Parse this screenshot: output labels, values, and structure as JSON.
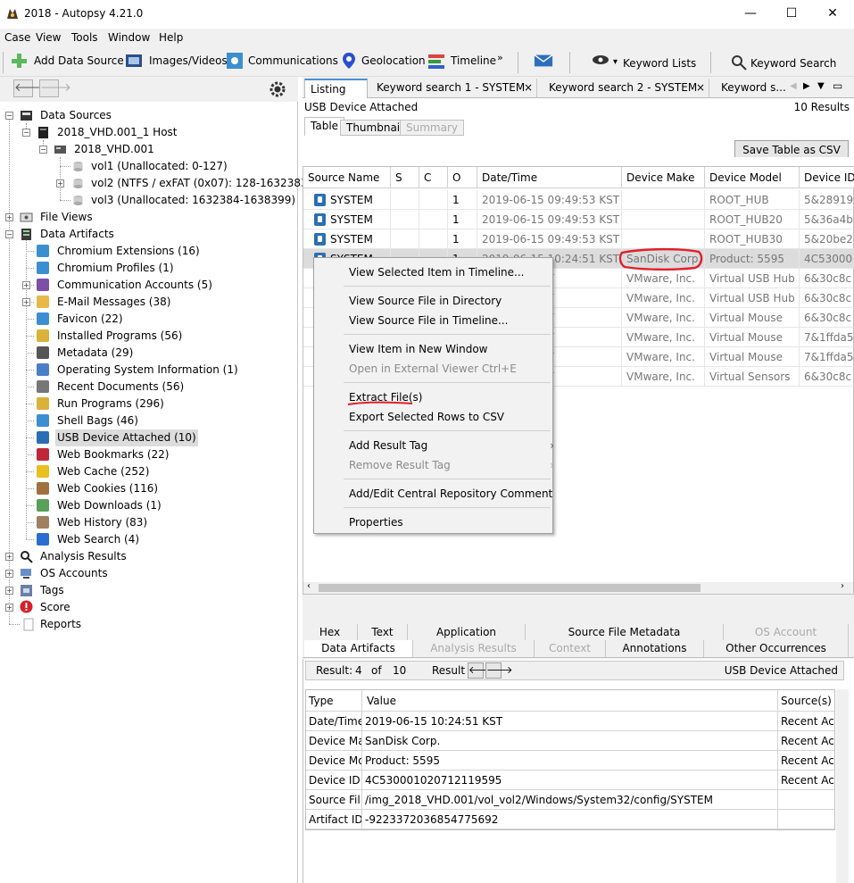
{
  "window": {
    "title": "2018 - Autopsy 4.21.0",
    "minimize": "—",
    "maximize": "☐",
    "close": "✕"
  },
  "menu": [
    "Case",
    "View",
    "Tools",
    "Window",
    "Help"
  ],
  "toolbar": {
    "add_data_source": "Add Data Source",
    "images_videos": "Images/Videos",
    "communications": "Communications",
    "geolocation": "Geolocation",
    "timeline": "Timeline",
    "timeline_more": "»",
    "keyword_lists": "Keyword Lists",
    "keyword_search": "Keyword Search"
  },
  "nav": {
    "back": "🡐",
    "forward": "🡒"
  },
  "tree": {
    "data_sources": "Data Sources",
    "host": "2018_VHD.001_1 Host",
    "image": "2018_VHD.001",
    "vol1": "vol1 (Unallocated: 0-127)",
    "vol2": "vol2 (NTFS / exFAT (0x07): 128-1632383)",
    "vol3": "vol3 (Unallocated: 1632384-1638399)",
    "file_views": "File Views",
    "data_artifacts": "Data Artifacts",
    "artifacts": [
      "Chromium Extensions (16)",
      "Chromium Profiles (1)",
      "Communication Accounts (5)",
      "E-Mail Messages (38)",
      "Favicon (22)",
      "Installed Programs (56)",
      "Metadata (29)",
      "Operating System Information (1)",
      "Recent Documents (56)",
      "Run Programs (296)",
      "Shell Bags (46)",
      "USB Device Attached (10)",
      "Web Bookmarks (22)",
      "Web Cache (252)",
      "Web Cookies (116)",
      "Web Downloads (1)",
      "Web History (83)",
      "Web Search (4)"
    ],
    "analysis_results": "Analysis Results",
    "os_accounts": "OS Accounts",
    "tags": "Tags",
    "score": "Score",
    "reports": "Reports"
  },
  "tabs": [
    "Listing",
    "Keyword search 1 - SYSTEM",
    "Keyword search 2 - SYSTEM",
    "Keyword s..."
  ],
  "tab_close": "×",
  "listing": {
    "header": "USB Device Attached",
    "results": "10  Results",
    "view_tabs": [
      "Table",
      "Thumbnail",
      "Summary"
    ],
    "save_button": "Save Table as CSV"
  },
  "grid": {
    "columns": [
      "Source Name",
      "S",
      "C",
      "O",
      "Date/Time",
      "Device Make",
      "Device Model",
      "Device ID"
    ],
    "rows": [
      [
        "SYSTEM",
        "",
        "",
        "1",
        "2019-06-15 09:49:53 KST",
        "",
        "ROOT_HUB",
        "5&28919"
      ],
      [
        "SYSTEM",
        "",
        "",
        "1",
        "2019-06-15 09:49:53 KST",
        "",
        "ROOT_HUB20",
        "5&36a4b"
      ],
      [
        "SYSTEM",
        "",
        "",
        "1",
        "2019-06-15 09:49:53 KST",
        "",
        "ROOT_HUB30",
        "5&20be2"
      ],
      [
        "SYSTEM",
        "",
        "",
        "1",
        "2019-06-15 10:24:51 KST",
        "SanDisk Corp.",
        "Product: 5595",
        "4C53000"
      ],
      [
        "",
        "",
        "",
        "",
        "09:49:54 KST",
        "VMware, Inc.",
        "Virtual USB Hub",
        "6&30c8c"
      ],
      [
        "",
        "",
        "",
        "",
        "09:49:54 KST",
        "VMware, Inc.",
        "Virtual USB Hub",
        "6&30c8c"
      ],
      [
        "",
        "",
        "",
        "",
        "09:49:53 KST",
        "VMware, Inc.",
        "Virtual Mouse",
        "6&30c8c"
      ],
      [
        "",
        "",
        "",
        "",
        "09:49:53 KST",
        "VMware, Inc.",
        "Virtual Mouse",
        "7&1ffda5"
      ],
      [
        "",
        "",
        "",
        "",
        "09:49:53 KST",
        "VMware, Inc.",
        "Virtual Mouse",
        "7&1ffda5"
      ],
      [
        "",
        "",
        "",
        "",
        "09:49:53 KST",
        "VMware, Inc.",
        "Virtual Sensors",
        "6&30c8c"
      ]
    ]
  },
  "context_menu": [
    "View Selected Item in Timeline...",
    "View Source File in Directory",
    "View Source File in Timeline...",
    "View Item in New Window",
    "Open in External Viewer  Ctrl+E",
    "Extract File(s)",
    "Export Selected Rows to CSV",
    "Add Result Tag",
    "Remove Result Tag",
    "Add/Edit Central Repository Comment",
    "Properties"
  ],
  "bottom_tabs_row1": [
    "Hex",
    "Text",
    "Application",
    "Source File Metadata",
    "OS Account"
  ],
  "bottom_tabs_row2": [
    "Data Artifacts",
    "Analysis Results",
    "Context",
    "Annotations",
    "Other Occurrences"
  ],
  "result_bar": {
    "result_label": "Result:",
    "current": "4",
    "of_label": "of",
    "total": "10",
    "result_nav_label": "Result",
    "type": "USB Device Attached"
  },
  "details": {
    "columns": [
      "Type",
      "Value",
      "Source(s)"
    ],
    "rows": [
      [
        "Date/Time",
        "2019-06-15 10:24:51 KST",
        "Recent Act"
      ],
      [
        "Device Ma",
        "SanDisk Corp.",
        "Recent Act"
      ],
      [
        "Device Mo",
        "Product: 5595",
        "Recent Act"
      ],
      [
        "Device ID",
        "4C530001020712119595",
        "Recent Act"
      ],
      [
        "Source Fil",
        "/img_2018_VHD.001/vol_vol2/Windows/System32/config/SYSTEM",
        ""
      ],
      [
        "Artifact ID",
        "-9223372036854775692",
        ""
      ]
    ]
  },
  "colors": {
    "highlight": "#e0202a",
    "selected_row": "#dcdcdc",
    "accent": "#4a90d9"
  }
}
